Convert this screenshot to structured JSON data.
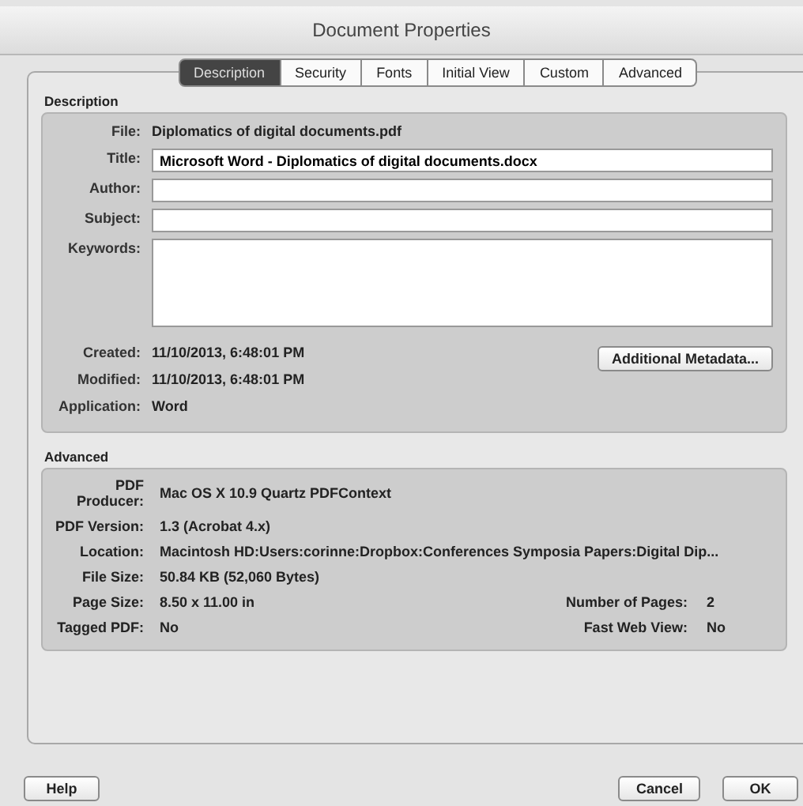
{
  "window": {
    "title": "Document Properties"
  },
  "tabs": [
    {
      "label": "Description",
      "selected": true
    },
    {
      "label": "Security",
      "selected": false
    },
    {
      "label": "Fonts",
      "selected": false
    },
    {
      "label": "Initial View",
      "selected": false
    },
    {
      "label": "Custom",
      "selected": false
    },
    {
      "label": "Advanced",
      "selected": false
    }
  ],
  "description": {
    "heading": "Description",
    "fields": [
      {
        "kind": "text",
        "label": "File:",
        "value": "Diplomatics of digital documents.pdf"
      },
      {
        "kind": "input",
        "label": "Title:",
        "value": "Microsoft Word - Diplomatics of digital documents.docx"
      },
      {
        "kind": "input",
        "label": "Author:"
      },
      {
        "kind": "input",
        "label": "Subject:"
      },
      {
        "kind": "textarea",
        "label": "Keywords:"
      }
    ],
    "dates": [
      {
        "label": "Created:",
        "value": "11/10/2013, 6:48:01 PM"
      },
      {
        "label": "Modified:",
        "value": "11/10/2013, 6:48:01 PM"
      },
      {
        "label": "Application:",
        "value": "Word"
      }
    ],
    "metadata_button": "Additional Metadata..."
  },
  "advanced": {
    "heading": "Advanced",
    "rows": [
      {
        "label": "PDF Producer:",
        "value": "Mac OS X 10.9 Quartz PDFContext"
      },
      {
        "label": "PDF Version:",
        "value": "1.3 (Acrobat 4.x)"
      },
      {
        "label": "Location:",
        "value": "Macintosh HD:Users:corinne:Dropbox:Conferences Symposia Papers:Digital Dip..."
      },
      {
        "label": "File Size:",
        "value": "50.84 KB (52,060 Bytes)"
      },
      {
        "label": "Page Size:",
        "value": "8.50 x 11.00 in",
        "side_label": "Number of Pages:",
        "side_value": "2"
      },
      {
        "label": "Tagged PDF:",
        "value": "No",
        "side_label": "Fast Web View:",
        "side_value": "No"
      }
    ]
  },
  "buttons": {
    "help": "Help",
    "cancel": "Cancel",
    "ok": "OK"
  }
}
